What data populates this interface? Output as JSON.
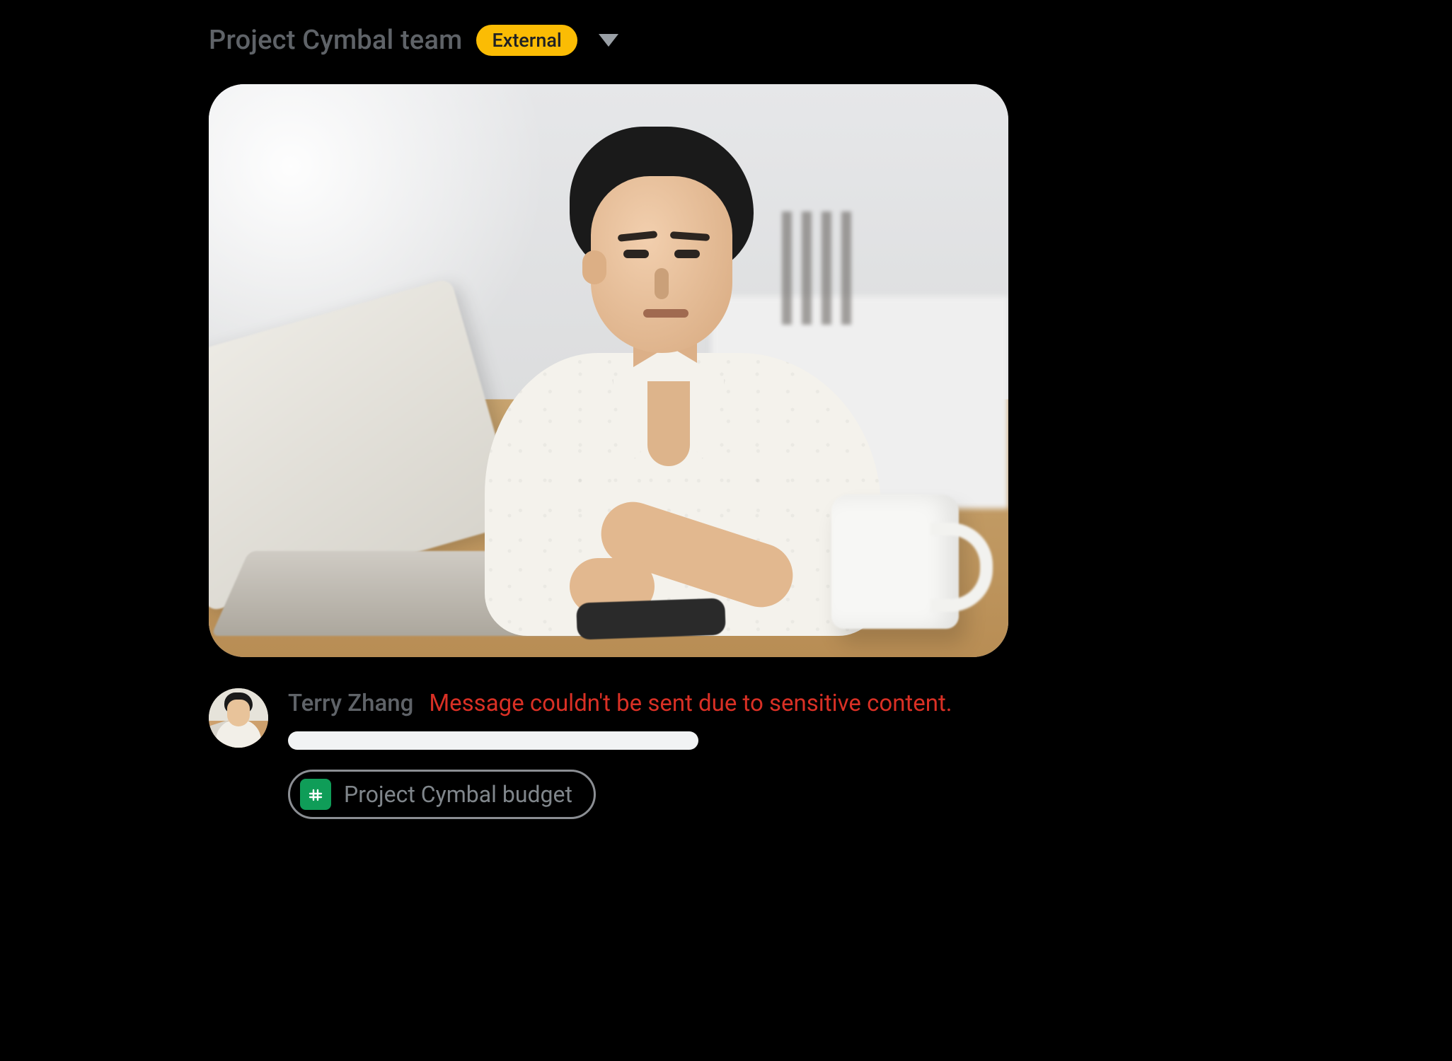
{
  "header": {
    "space_title": "Project Cymbal team",
    "external_badge": "External"
  },
  "message": {
    "sender_name": "Terry Zhang",
    "error_text": "Message couldn't be sent due to sensitive content."
  },
  "attachment": {
    "file_name": "Project Cymbal budget",
    "file_type": "google-sheets"
  },
  "colors": {
    "badge_bg": "#fbbc04",
    "error": "#d93025",
    "sheets_green": "#0f9d58"
  }
}
